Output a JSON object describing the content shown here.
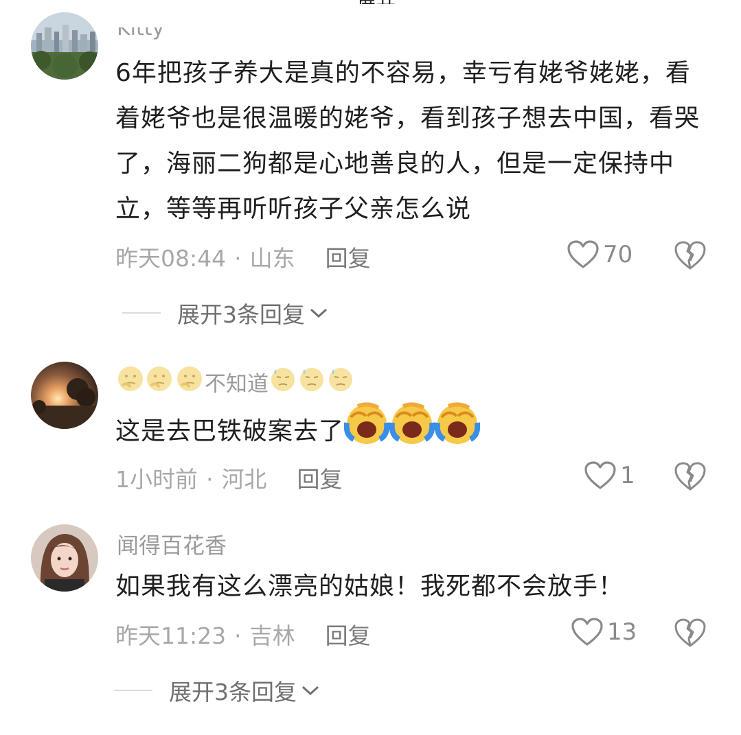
{
  "top_cut_text": "展开",
  "comments": [
    {
      "username": "Kitty",
      "text": "6年把孩子养大是真的不容易，幸亏有姥爷姥姥，看着姥爷也是很温暖的姥爷，看到孩子想去中国，看哭了，海丽二狗都是心地善良的人，但是一定保持中立，等等再听听孩子父亲怎么说",
      "time": "昨天08:44",
      "location": "山东",
      "reply_label": "回复",
      "likes": "70",
      "expand_label": "展开3条回复"
    },
    {
      "username": "不知道",
      "username_emoji_before": [
        "thinking-emoji",
        "thinking-emoji",
        "thinking-emoji"
      ],
      "username_emoji_after": [
        "downcast-sweat-emoji",
        "downcast-sweat-emoji",
        "downcast-sweat-emoji"
      ],
      "text": "这是去巴铁破案去了",
      "text_emoji_after": [
        "loudly-crying-laughing-emoji",
        "loudly-crying-laughing-emoji",
        "loudly-crying-laughing-emoji"
      ],
      "time": "1小时前",
      "location": "河北",
      "reply_label": "回复",
      "likes": "1"
    },
    {
      "username": "闻得百花香",
      "text": "如果我有这么漂亮的姑娘！我死都不会放手！",
      "time": "昨天11:23",
      "location": "吉林",
      "reply_label": "回复",
      "likes": "13",
      "expand_label": "展开3条回复"
    }
  ],
  "meta_separator": "·",
  "colors": {
    "meta_gray": "#a8a8a8",
    "text_dark": "#1f1f1f",
    "emoji_yellow": "#f7c948",
    "emoji_blue": "#3b8ee8"
  }
}
